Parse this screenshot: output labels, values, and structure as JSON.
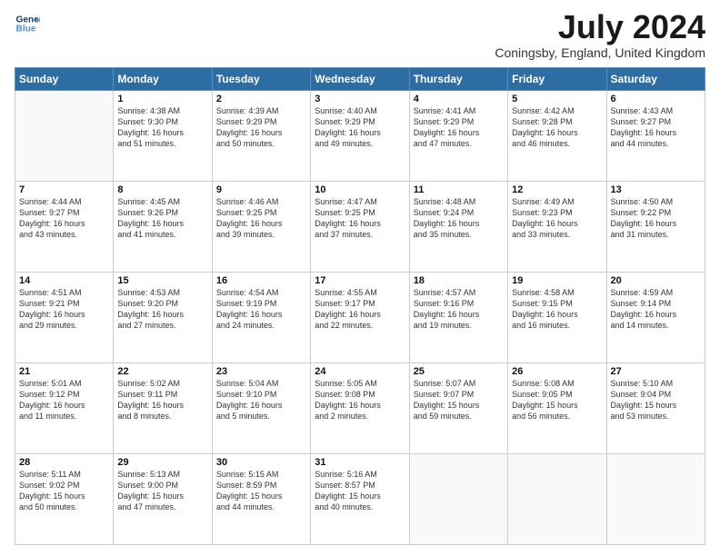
{
  "logo": {
    "line1": "General",
    "line2": "Blue"
  },
  "title": "July 2024",
  "location": "Coningsby, England, United Kingdom",
  "days_header": [
    "Sunday",
    "Monday",
    "Tuesday",
    "Wednesday",
    "Thursday",
    "Friday",
    "Saturday"
  ],
  "weeks": [
    [
      {
        "num": "",
        "info": ""
      },
      {
        "num": "1",
        "info": "Sunrise: 4:38 AM\nSunset: 9:30 PM\nDaylight: 16 hours\nand 51 minutes."
      },
      {
        "num": "2",
        "info": "Sunrise: 4:39 AM\nSunset: 9:29 PM\nDaylight: 16 hours\nand 50 minutes."
      },
      {
        "num": "3",
        "info": "Sunrise: 4:40 AM\nSunset: 9:29 PM\nDaylight: 16 hours\nand 49 minutes."
      },
      {
        "num": "4",
        "info": "Sunrise: 4:41 AM\nSunset: 9:29 PM\nDaylight: 16 hours\nand 47 minutes."
      },
      {
        "num": "5",
        "info": "Sunrise: 4:42 AM\nSunset: 9:28 PM\nDaylight: 16 hours\nand 46 minutes."
      },
      {
        "num": "6",
        "info": "Sunrise: 4:43 AM\nSunset: 9:27 PM\nDaylight: 16 hours\nand 44 minutes."
      }
    ],
    [
      {
        "num": "7",
        "info": "Sunrise: 4:44 AM\nSunset: 9:27 PM\nDaylight: 16 hours\nand 43 minutes."
      },
      {
        "num": "8",
        "info": "Sunrise: 4:45 AM\nSunset: 9:26 PM\nDaylight: 16 hours\nand 41 minutes."
      },
      {
        "num": "9",
        "info": "Sunrise: 4:46 AM\nSunset: 9:25 PM\nDaylight: 16 hours\nand 39 minutes."
      },
      {
        "num": "10",
        "info": "Sunrise: 4:47 AM\nSunset: 9:25 PM\nDaylight: 16 hours\nand 37 minutes."
      },
      {
        "num": "11",
        "info": "Sunrise: 4:48 AM\nSunset: 9:24 PM\nDaylight: 16 hours\nand 35 minutes."
      },
      {
        "num": "12",
        "info": "Sunrise: 4:49 AM\nSunset: 9:23 PM\nDaylight: 16 hours\nand 33 minutes."
      },
      {
        "num": "13",
        "info": "Sunrise: 4:50 AM\nSunset: 9:22 PM\nDaylight: 16 hours\nand 31 minutes."
      }
    ],
    [
      {
        "num": "14",
        "info": "Sunrise: 4:51 AM\nSunset: 9:21 PM\nDaylight: 16 hours\nand 29 minutes."
      },
      {
        "num": "15",
        "info": "Sunrise: 4:53 AM\nSunset: 9:20 PM\nDaylight: 16 hours\nand 27 minutes."
      },
      {
        "num": "16",
        "info": "Sunrise: 4:54 AM\nSunset: 9:19 PM\nDaylight: 16 hours\nand 24 minutes."
      },
      {
        "num": "17",
        "info": "Sunrise: 4:55 AM\nSunset: 9:17 PM\nDaylight: 16 hours\nand 22 minutes."
      },
      {
        "num": "18",
        "info": "Sunrise: 4:57 AM\nSunset: 9:16 PM\nDaylight: 16 hours\nand 19 minutes."
      },
      {
        "num": "19",
        "info": "Sunrise: 4:58 AM\nSunset: 9:15 PM\nDaylight: 16 hours\nand 16 minutes."
      },
      {
        "num": "20",
        "info": "Sunrise: 4:59 AM\nSunset: 9:14 PM\nDaylight: 16 hours\nand 14 minutes."
      }
    ],
    [
      {
        "num": "21",
        "info": "Sunrise: 5:01 AM\nSunset: 9:12 PM\nDaylight: 16 hours\nand 11 minutes."
      },
      {
        "num": "22",
        "info": "Sunrise: 5:02 AM\nSunset: 9:11 PM\nDaylight: 16 hours\nand 8 minutes."
      },
      {
        "num": "23",
        "info": "Sunrise: 5:04 AM\nSunset: 9:10 PM\nDaylight: 16 hours\nand 5 minutes."
      },
      {
        "num": "24",
        "info": "Sunrise: 5:05 AM\nSunset: 9:08 PM\nDaylight: 16 hours\nand 2 minutes."
      },
      {
        "num": "25",
        "info": "Sunrise: 5:07 AM\nSunset: 9:07 PM\nDaylight: 15 hours\nand 59 minutes."
      },
      {
        "num": "26",
        "info": "Sunrise: 5:08 AM\nSunset: 9:05 PM\nDaylight: 15 hours\nand 56 minutes."
      },
      {
        "num": "27",
        "info": "Sunrise: 5:10 AM\nSunset: 9:04 PM\nDaylight: 15 hours\nand 53 minutes."
      }
    ],
    [
      {
        "num": "28",
        "info": "Sunrise: 5:11 AM\nSunset: 9:02 PM\nDaylight: 15 hours\nand 50 minutes."
      },
      {
        "num": "29",
        "info": "Sunrise: 5:13 AM\nSunset: 9:00 PM\nDaylight: 15 hours\nand 47 minutes."
      },
      {
        "num": "30",
        "info": "Sunrise: 5:15 AM\nSunset: 8:59 PM\nDaylight: 15 hours\nand 44 minutes."
      },
      {
        "num": "31",
        "info": "Sunrise: 5:16 AM\nSunset: 8:57 PM\nDaylight: 15 hours\nand 40 minutes."
      },
      {
        "num": "",
        "info": ""
      },
      {
        "num": "",
        "info": ""
      },
      {
        "num": "",
        "info": ""
      }
    ]
  ]
}
